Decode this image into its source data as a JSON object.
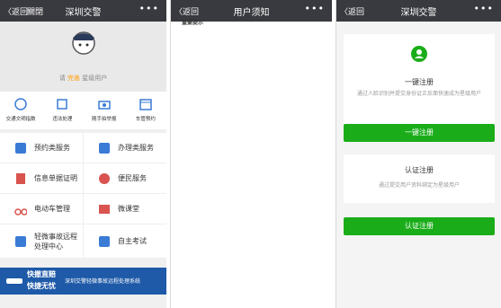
{
  "panel_home": {
    "nav": {
      "back": "〈返回",
      "close": "關閉",
      "title": "深圳交警",
      "more": "•••"
    },
    "hero": {
      "pre": "请",
      "level": "完善",
      "post": "星级用户"
    },
    "quick": [
      "交通文明指数",
      "违法处理",
      "随手拍举报",
      "车管预约"
    ],
    "services": [
      [
        "预约类服务",
        "办理类服务"
      ],
      [
        "信息单据证明",
        "便民服务"
      ],
      [
        "电动车管理",
        "微课堂"
      ],
      [
        "轻微事故远程处理中心",
        "自主考试"
      ]
    ],
    "banner": {
      "line1": "快撤直赔",
      "line2": "快捷无忧",
      "text": "深圳交警轻微事故远程处理系统"
    },
    "colors": {
      "nav": "#393a3f",
      "banner": "#1e5aa8",
      "highlight": "#ff9900"
    }
  },
  "panel_notice": {
    "nav": {
      "back": "〈返回",
      "title": "用户须知",
      "more": "•••"
    },
    "paragraphs": [
      {
        "style": "h",
        "text": "重要提示"
      }
    ]
  },
  "panel_register": {
    "nav": {
      "back": "〈返回",
      "title": "深圳交警",
      "more": "•••"
    },
    "card1": {
      "title": "一键注册",
      "desc": "通过人脸识别并提交身份证正反面快速成为星级用户",
      "button": "一键注册"
    },
    "card2": {
      "title": "认证注册",
      "desc": "通过提交用户资料绑定为星级用户",
      "button": "认证注册"
    },
    "colors": {
      "button": "#1aad19"
    }
  }
}
